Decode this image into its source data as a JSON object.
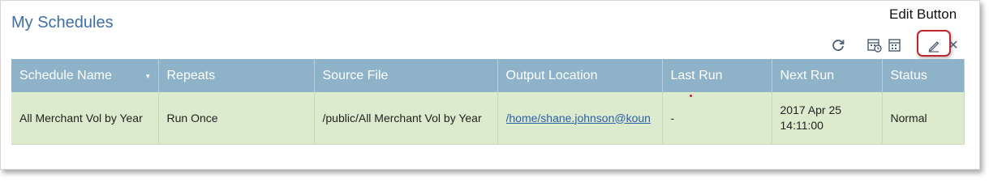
{
  "header": {
    "title": "My Schedules",
    "callout_label": "Edit Button"
  },
  "toolbar": {
    "icons": [
      "refresh-icon",
      "calendar-history-icon",
      "calendar-list-icon",
      "pencil-icon",
      "close-icon"
    ]
  },
  "table": {
    "columns": [
      "Schedule Name",
      "Repeats",
      "Source File",
      "Output Location",
      "Last Run",
      "Next Run",
      "Status"
    ],
    "rows": [
      {
        "schedule_name": "All Merchant Vol by Year",
        "repeats": "Run Once",
        "source_file": "/public/All Merchant Vol by Year",
        "output_location": "/home/shane.johnson@koun",
        "last_run": "-",
        "next_run": "2017 Apr 25 14:11:00",
        "status": "Normal"
      }
    ]
  },
  "colors": {
    "title": "#3f6fa8",
    "header_bg": "#8eb3c9",
    "row_bg": "#dcebcd",
    "highlight": "#c0272d"
  }
}
